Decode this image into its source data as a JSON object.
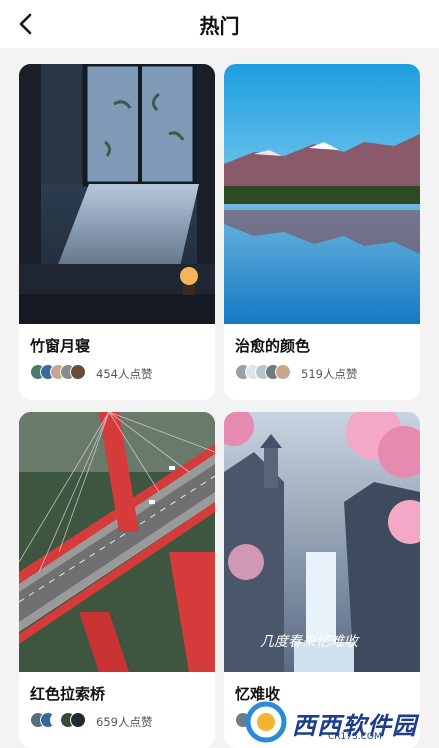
{
  "header": {
    "title": "热门",
    "back_icon": "chevron-left-icon"
  },
  "cards": [
    {
      "name": "竹窗月寝",
      "likes": "454人点赞"
    },
    {
      "name": "治愈的颜色",
      "likes": "519人点赞"
    },
    {
      "name": "红色拉索桥",
      "likes": "659人点赞"
    },
    {
      "name": "忆难收",
      "overlay_text": "几度春来忆难收"
    }
  ],
  "watermark": {
    "text": "西西软件园",
    "domain": "CR173.COM"
  },
  "colors": {
    "header_bg": "#ffffff",
    "page_bg": "#f3f3f3",
    "bridge_red": "#d63b3b",
    "watermark_blue": "#1c3e8c"
  }
}
